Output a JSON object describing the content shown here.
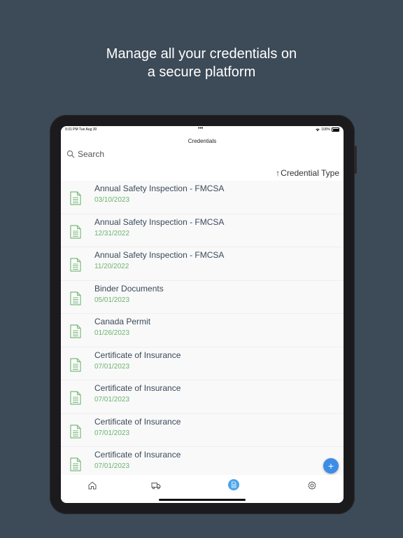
{
  "headline": {
    "line1": "Manage all your credentials on",
    "line2": "a secure platform"
  },
  "status_bar": {
    "time": "9:31 PM  Tue Aug 30",
    "dots": "•••",
    "battery": "100%"
  },
  "nav": {
    "title": "Credentials"
  },
  "search": {
    "placeholder": "Search"
  },
  "sort": {
    "arrow": "↑",
    "label": "Credential Type"
  },
  "credentials": [
    {
      "title": "Annual Safety Inspection - FMCSA",
      "date": "03/10/2023"
    },
    {
      "title": "Annual Safety Inspection - FMCSA",
      "date": "12/31/2022"
    },
    {
      "title": "Annual Safety Inspection - FMCSA",
      "date": "11/20/2022"
    },
    {
      "title": "Binder Documents",
      "date": "05/01/2023"
    },
    {
      "title": "Canada Permit",
      "date": "01/26/2023"
    },
    {
      "title": "Certificate of Insurance",
      "date": "07/01/2023"
    },
    {
      "title": "Certificate of Insurance",
      "date": "07/01/2023"
    },
    {
      "title": "Certificate of Insurance",
      "date": "07/01/2023"
    },
    {
      "title": "Certificate of Insurance",
      "date": "07/01/2023"
    }
  ],
  "fab": {
    "label": "+"
  },
  "tabs": {
    "home": "home-icon",
    "truck": "truck-icon",
    "documents": "document-icon",
    "settings": "gear-icon"
  },
  "colors": {
    "background": "#3d4a58",
    "accent": "#3d8de6",
    "date_green": "#6bb36e",
    "doc_icon_green": "#79b77b"
  }
}
